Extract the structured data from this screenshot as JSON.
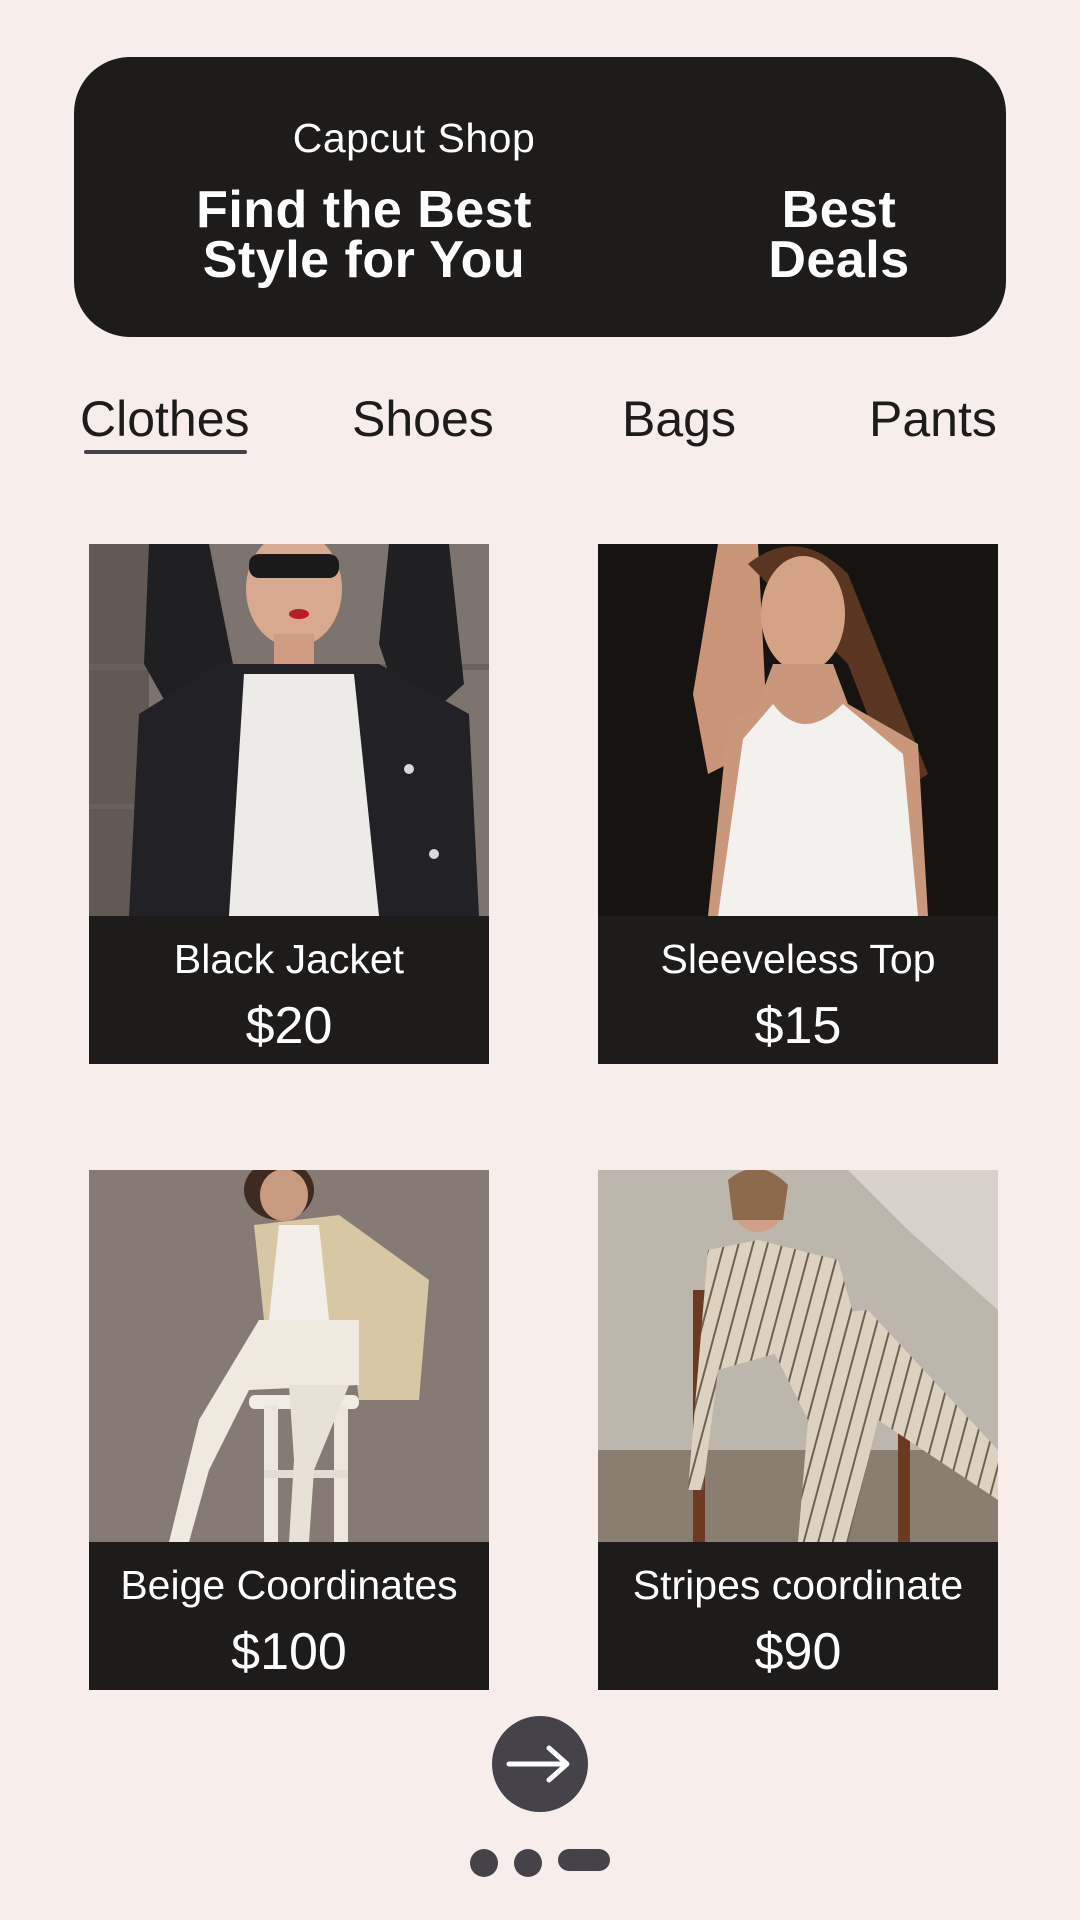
{
  "banner": {
    "shop_name": "Capcut Shop",
    "tagline_line1": "Find the Best",
    "tagline_line2": "Style for You",
    "deals_line1": "Best",
    "deals_line2": "Deals"
  },
  "tabs": [
    {
      "label": "Clothes",
      "active": true
    },
    {
      "label": "Shoes",
      "active": false
    },
    {
      "label": "Bags",
      "active": false
    },
    {
      "label": "Pants",
      "active": false
    }
  ],
  "products": [
    {
      "name": "Black Jacket",
      "price": "$20"
    },
    {
      "name": "Sleeveless Top",
      "price": "$15"
    },
    {
      "name": "Beige Coordinates",
      "price": "$100"
    },
    {
      "name": "Stripes coordinate",
      "price": "$90"
    }
  ],
  "next_button": {
    "icon": "arrow-right-icon"
  },
  "pager": {
    "pages": 3,
    "current": 3
  },
  "colors": {
    "background": "#f7eeec",
    "dark": "#1e1c1a",
    "accent": "#45424a",
    "text_light": "#ffffff"
  }
}
